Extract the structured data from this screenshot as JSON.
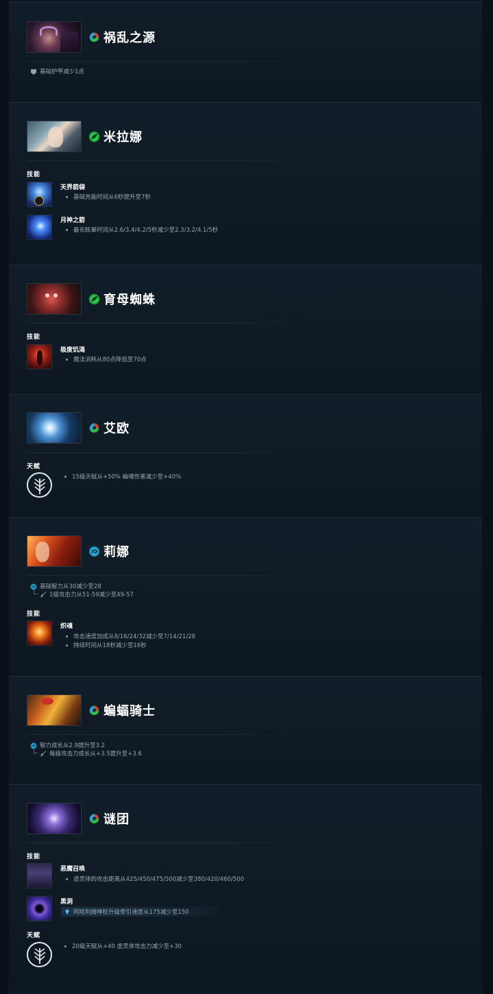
{
  "colors": {
    "bg": "#0a1119",
    "panel": "#111d28",
    "universal": "#c4473b",
    "agility": "#2dc24a",
    "intelligence": "#2aa6d6"
  },
  "heroes": [
    {
      "name": "祸乱之源",
      "attribute_icon": "universal-icon",
      "stats": [
        {
          "icon": "armor-icon",
          "text": "基础护甲减少1点"
        }
      ]
    },
    {
      "name": "米拉娜",
      "attribute_icon": "agility-icon",
      "abilities_label": "技能",
      "abilities": [
        {
          "name": "天界箭袋",
          "lines": [
            "基础充能时间从6秒提升至7秒"
          ]
        },
        {
          "name": "月神之箭",
          "lines": [
            "最长眩晕时间从2.6/3.4/4.2/5秒减少至2.3/3.2/4.1/5秒"
          ]
        }
      ]
    },
    {
      "name": "育母蜘蛛",
      "attribute_icon": "agility-icon",
      "abilities_label": "技能",
      "abilities": [
        {
          "name": "极度饥渴",
          "lines": [
            "魔法消耗从80点降低至70点"
          ]
        }
      ]
    },
    {
      "name": "艾欧",
      "attribute_icon": "universal-icon",
      "talents_label": "天赋",
      "talents": [
        "15级天赋从+50% 幽魂伤害减少至+40%"
      ]
    },
    {
      "name": "莉娜",
      "attribute_icon": "intelligence-icon",
      "stats": [
        {
          "icon": "intelligence-icon",
          "text": "基础智力从30减少至28"
        },
        {
          "icon": "sword-icon",
          "text": "1级攻击力从51-59减少至49-57"
        }
      ],
      "abilities_label": "技能",
      "abilities": [
        {
          "name": "炽魂",
          "lines": [
            "攻击速度加成从8/16/24/32减少至7/14/21/28",
            "持续时间从18秒减少至16秒"
          ]
        }
      ]
    },
    {
      "name": "蝙蝠骑士",
      "attribute_icon": "universal-icon",
      "stats": [
        {
          "icon": "intelligence-icon",
          "text": "智力成长从2.9提升至3.2"
        },
        {
          "icon": "sword-icon",
          "text": "每级攻击力成长从+3.5提升至+3.6"
        }
      ]
    },
    {
      "name": "谜团",
      "attribute_icon": "universal-icon",
      "abilities_label": "技能",
      "abilities": [
        {
          "name": "恶魔召唤",
          "lines": [
            "虚灵体的攻击距离从425/450/475/500减少至380/420/460/500"
          ]
        },
        {
          "name": "黑洞",
          "lines": [
            "阿哈利姆神杖升级牵引速度从175减少至150"
          ]
        }
      ],
      "talents_label": "天赋",
      "talents": [
        "20级天赋从+40 虚灵体攻击力减少至+30"
      ]
    }
  ]
}
